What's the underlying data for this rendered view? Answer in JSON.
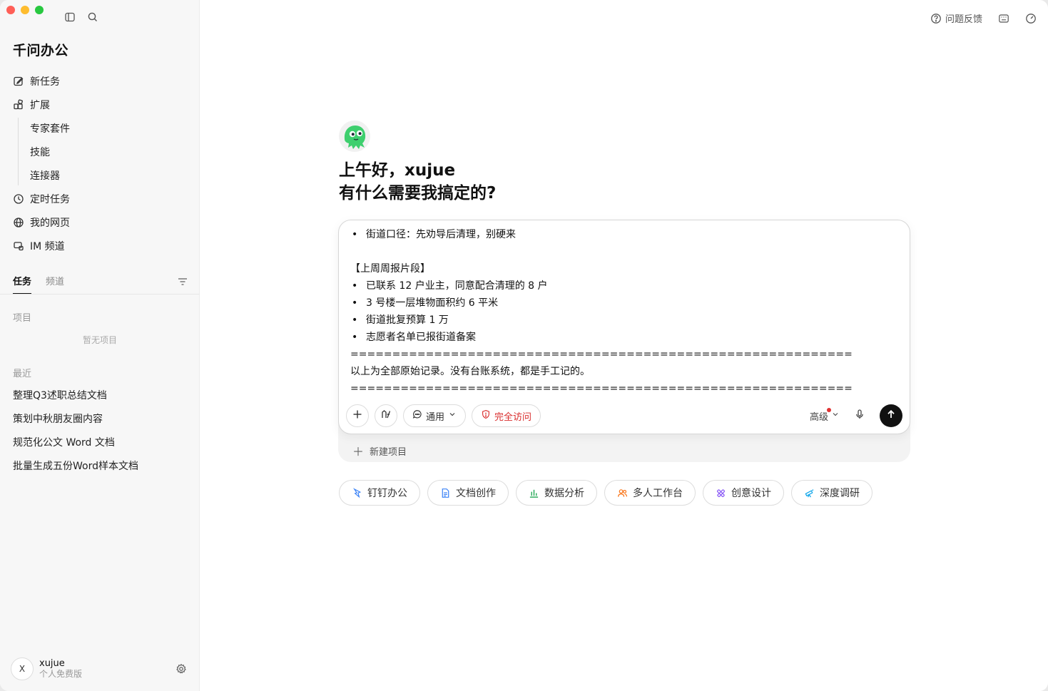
{
  "app": {
    "title": "千问办公"
  },
  "sidebar": {
    "nav": [
      {
        "label": "新任务",
        "icon": "edit-icon"
      },
      {
        "label": "扩展",
        "icon": "extension-icon"
      }
    ],
    "extension_subitems": [
      "专家套件",
      "技能",
      "连接器"
    ],
    "nav_bottom": [
      {
        "label": "定时任务",
        "icon": "clock-icon"
      },
      {
        "label": "我的网页",
        "icon": "globe-icon"
      },
      {
        "label": "IM 频道",
        "icon": "im-channel-icon"
      }
    ],
    "tabs": [
      {
        "label": "任务",
        "active": true
      },
      {
        "label": "频道",
        "active": false
      }
    ],
    "projects_label": "项目",
    "projects_empty": "暂无项目",
    "recent_label": "最近",
    "recent_items": [
      "整理Q3述职总结文档",
      "策划中秋朋友圈内容",
      "规范化公文 Word 文档",
      "批量生成五份Word样本文档"
    ],
    "user": {
      "avatar_letter": "X",
      "name": "xujue",
      "plan": "个人免费版"
    }
  },
  "header": {
    "feedback_label": "问题反馈"
  },
  "main": {
    "greeting_line1": "上午好，xujue",
    "greeting_line2": "有什么需要我搞定的?",
    "composer": {
      "lines": [
        {
          "bullet": true,
          "text": "街道口径：先劝导后清理，别硬来"
        },
        {
          "bullet": false,
          "text": ""
        },
        {
          "bullet": false,
          "text": "【上周周报片段】"
        },
        {
          "bullet": true,
          "text": "已联系 12 户业主，同意配合清理的 8 户"
        },
        {
          "bullet": true,
          "text": "3 号楼一层堆物面积约 6 平米"
        },
        {
          "bullet": true,
          "text": "街道批复预算 1 万"
        },
        {
          "bullet": true,
          "text": "志愿者名单已报街道备案"
        },
        {
          "bullet": false,
          "text": "============================================================"
        },
        {
          "bullet": false,
          "text": "以上为全部原始记录。没有台账系统，都是手工记的。"
        },
        {
          "bullet": false,
          "text": "============================================================"
        }
      ],
      "mode_label": "通用",
      "access_label": "完全访问",
      "advanced_label": "高级",
      "new_project_label": "新建项目"
    },
    "chips": [
      {
        "label": "钉钉办公",
        "icon": "dingtalk-icon",
        "color": "#3b82f6"
      },
      {
        "label": "文档创作",
        "icon": "document-icon",
        "color": "#3b82f6"
      },
      {
        "label": "数据分析",
        "icon": "chart-icon",
        "color": "#16a34a"
      },
      {
        "label": "多人工作台",
        "icon": "users-icon",
        "color": "#f97316"
      },
      {
        "label": "创意设计",
        "icon": "design-icon",
        "color": "#8b5cf6"
      },
      {
        "label": "深度调研",
        "icon": "telescope-icon",
        "color": "#0ea5e9"
      }
    ]
  }
}
